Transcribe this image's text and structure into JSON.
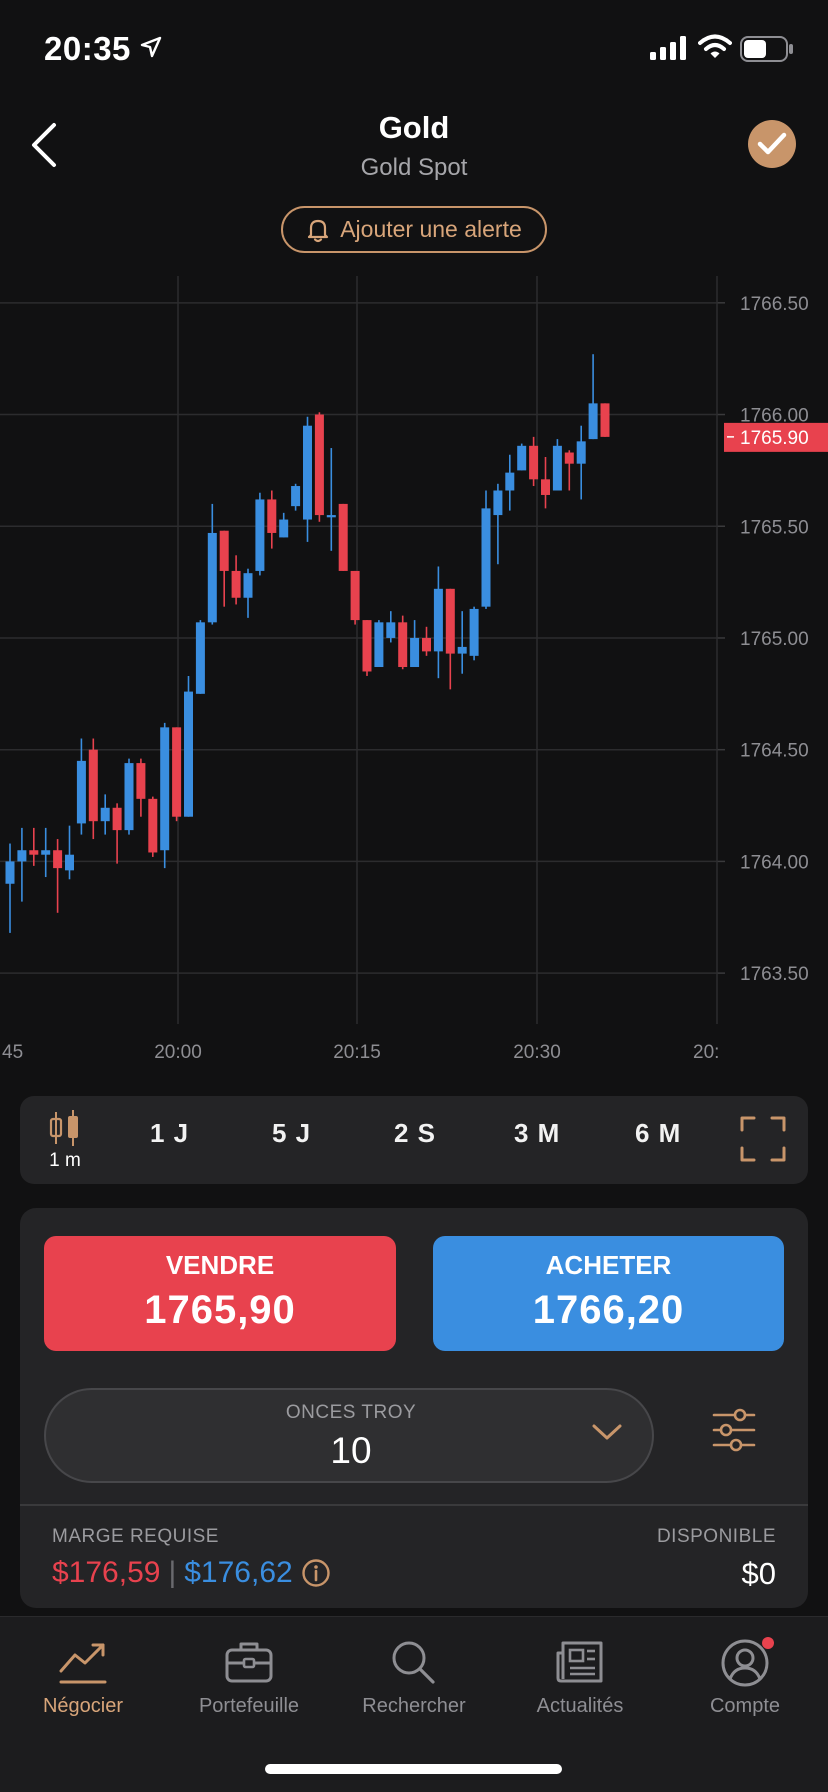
{
  "status_bar": {
    "time": "20:35"
  },
  "header": {
    "title": "Gold",
    "subtitle": "Gold Spot",
    "alert_button": "Ajouter une alerte"
  },
  "colors": {
    "up": "#3a8ee0",
    "down": "#e8424e",
    "accent": "#c8956a",
    "background": "#111112"
  },
  "chart_data": {
    "type": "candlestick",
    "y_ticks": [
      "1766.50",
      "1766.00",
      "1765.50",
      "1765.00",
      "1764.50",
      "1764.00",
      "1763.50"
    ],
    "x_ticks": [
      "45",
      "20:00",
      "20:15",
      "20:30",
      "20:"
    ],
    "ylim": [
      1763.42,
      1766.62
    ],
    "current_price": "1765.90",
    "grid": true,
    "candles": [
      {
        "o": 1763.9,
        "c": 1764.0,
        "h": 1764.08,
        "l": 1763.68,
        "dir": "up"
      },
      {
        "o": 1764.0,
        "c": 1764.05,
        "h": 1764.15,
        "l": 1763.82,
        "dir": "up"
      },
      {
        "o": 1764.05,
        "c": 1764.03,
        "h": 1764.15,
        "l": 1763.98,
        "dir": "down"
      },
      {
        "o": 1764.03,
        "c": 1764.05,
        "h": 1764.15,
        "l": 1763.93,
        "dir": "up"
      },
      {
        "o": 1764.05,
        "c": 1763.97,
        "h": 1764.1,
        "l": 1763.77,
        "dir": "down"
      },
      {
        "o": 1763.96,
        "c": 1764.03,
        "h": 1764.16,
        "l": 1763.92,
        "dir": "up"
      },
      {
        "o": 1764.17,
        "c": 1764.45,
        "h": 1764.55,
        "l": 1764.12,
        "dir": "up"
      },
      {
        "o": 1764.5,
        "c": 1764.18,
        "h": 1764.55,
        "l": 1764.1,
        "dir": "down"
      },
      {
        "o": 1764.18,
        "c": 1764.24,
        "h": 1764.3,
        "l": 1764.12,
        "dir": "up"
      },
      {
        "o": 1764.24,
        "c": 1764.14,
        "h": 1764.26,
        "l": 1763.99,
        "dir": "down"
      },
      {
        "o": 1764.14,
        "c": 1764.44,
        "h": 1764.46,
        "l": 1764.12,
        "dir": "up"
      },
      {
        "o": 1764.44,
        "c": 1764.28,
        "h": 1764.46,
        "l": 1764.2,
        "dir": "down"
      },
      {
        "o": 1764.28,
        "c": 1764.04,
        "h": 1764.29,
        "l": 1764.02,
        "dir": "down"
      },
      {
        "o": 1764.05,
        "c": 1764.6,
        "h": 1764.62,
        "l": 1763.97,
        "dir": "up"
      },
      {
        "o": 1764.6,
        "c": 1764.2,
        "h": 1764.6,
        "l": 1764.18,
        "dir": "down"
      },
      {
        "o": 1764.2,
        "c": 1764.76,
        "h": 1764.83,
        "l": 1764.2,
        "dir": "up"
      },
      {
        "o": 1764.75,
        "c": 1765.07,
        "h": 1765.08,
        "l": 1764.75,
        "dir": "up"
      },
      {
        "o": 1765.07,
        "c": 1765.47,
        "h": 1765.6,
        "l": 1765.06,
        "dir": "up"
      },
      {
        "o": 1765.48,
        "c": 1765.3,
        "h": 1765.48,
        "l": 1765.14,
        "dir": "down"
      },
      {
        "o": 1765.3,
        "c": 1765.18,
        "h": 1765.37,
        "l": 1765.15,
        "dir": "down"
      },
      {
        "o": 1765.18,
        "c": 1765.29,
        "h": 1765.31,
        "l": 1765.09,
        "dir": "up"
      },
      {
        "o": 1765.3,
        "c": 1765.62,
        "h": 1765.65,
        "l": 1765.28,
        "dir": "up"
      },
      {
        "o": 1765.62,
        "c": 1765.47,
        "h": 1765.66,
        "l": 1765.4,
        "dir": "down"
      },
      {
        "o": 1765.45,
        "c": 1765.53,
        "h": 1765.56,
        "l": 1765.45,
        "dir": "up"
      },
      {
        "o": 1765.59,
        "c": 1765.68,
        "h": 1765.69,
        "l": 1765.57,
        "dir": "up"
      },
      {
        "o": 1765.53,
        "c": 1765.95,
        "h": 1765.99,
        "l": 1765.43,
        "dir": "up"
      },
      {
        "o": 1766.0,
        "c": 1765.55,
        "h": 1766.01,
        "l": 1765.52,
        "dir": "down"
      },
      {
        "o": 1765.54,
        "c": 1765.55,
        "h": 1765.85,
        "l": 1765.39,
        "dir": "up"
      },
      {
        "o": 1765.6,
        "c": 1765.3,
        "h": 1765.6,
        "l": 1765.3,
        "dir": "down"
      },
      {
        "o": 1765.3,
        "c": 1765.08,
        "h": 1765.3,
        "l": 1765.06,
        "dir": "down"
      },
      {
        "o": 1765.08,
        "c": 1764.85,
        "h": 1765.08,
        "l": 1764.83,
        "dir": "down"
      },
      {
        "o": 1764.87,
        "c": 1765.07,
        "h": 1765.08,
        "l": 1764.87,
        "dir": "up"
      },
      {
        "o": 1765.07,
        "c": 1765.0,
        "h": 1765.12,
        "l": 1764.98,
        "dir": "up"
      },
      {
        "o": 1765.07,
        "c": 1764.87,
        "h": 1765.1,
        "l": 1764.86,
        "dir": "down"
      },
      {
        "o": 1764.87,
        "c": 1765.0,
        "h": 1765.08,
        "l": 1764.87,
        "dir": "up"
      },
      {
        "o": 1765.0,
        "c": 1764.94,
        "h": 1765.05,
        "l": 1764.92,
        "dir": "down"
      },
      {
        "o": 1764.94,
        "c": 1765.22,
        "h": 1765.32,
        "l": 1764.82,
        "dir": "up"
      },
      {
        "o": 1765.22,
        "c": 1764.93,
        "h": 1765.22,
        "l": 1764.77,
        "dir": "down"
      },
      {
        "o": 1764.93,
        "c": 1764.96,
        "h": 1765.12,
        "l": 1764.84,
        "dir": "up"
      },
      {
        "o": 1764.92,
        "c": 1765.13,
        "h": 1765.14,
        "l": 1764.9,
        "dir": "up"
      },
      {
        "o": 1765.14,
        "c": 1765.58,
        "h": 1765.66,
        "l": 1765.13,
        "dir": "up"
      },
      {
        "o": 1765.55,
        "c": 1765.66,
        "h": 1765.69,
        "l": 1765.33,
        "dir": "up"
      },
      {
        "o": 1765.66,
        "c": 1765.74,
        "h": 1765.82,
        "l": 1765.57,
        "dir": "up"
      },
      {
        "o": 1765.75,
        "c": 1765.86,
        "h": 1765.87,
        "l": 1765.75,
        "dir": "up"
      },
      {
        "o": 1765.86,
        "c": 1765.71,
        "h": 1765.9,
        "l": 1765.68,
        "dir": "down"
      },
      {
        "o": 1765.71,
        "c": 1765.64,
        "h": 1765.81,
        "l": 1765.58,
        "dir": "down"
      },
      {
        "o": 1765.66,
        "c": 1765.86,
        "h": 1765.89,
        "l": 1765.66,
        "dir": "up"
      },
      {
        "o": 1765.83,
        "c": 1765.78,
        "h": 1765.84,
        "l": 1765.66,
        "dir": "down"
      },
      {
        "o": 1765.78,
        "c": 1765.88,
        "h": 1765.95,
        "l": 1765.62,
        "dir": "up"
      },
      {
        "o": 1765.89,
        "c": 1766.05,
        "h": 1766.27,
        "l": 1765.89,
        "dir": "up"
      },
      {
        "o": 1766.05,
        "c": 1765.9,
        "h": 1766.05,
        "l": 1765.9,
        "dir": "down"
      }
    ]
  },
  "timeframes": {
    "candle_label": "1 m",
    "items": [
      "1 J",
      "5 J",
      "2 S",
      "3 M",
      "6 M"
    ]
  },
  "trade": {
    "sell_label": "VENDRE",
    "sell_price": "1765,90",
    "buy_label": "ACHETER",
    "buy_price": "1766,20",
    "quantity_label": "ONCES TROY",
    "quantity_value": "10",
    "margin_label": "MARGE REQUISE",
    "margin_sell": "$176,59",
    "margin_sep": "|",
    "margin_buy": "$176,62",
    "available_label": "DISPONIBLE",
    "available_value": "$0"
  },
  "nav": {
    "items": [
      {
        "label": "Négocier",
        "icon": "chart-trend-icon",
        "active": true
      },
      {
        "label": "Portefeuille",
        "icon": "briefcase-icon",
        "active": false
      },
      {
        "label": "Rechercher",
        "icon": "search-icon",
        "active": false
      },
      {
        "label": "Actualités",
        "icon": "newspaper-icon",
        "active": false
      },
      {
        "label": "Compte",
        "icon": "user-circle-icon",
        "active": false
      }
    ]
  }
}
